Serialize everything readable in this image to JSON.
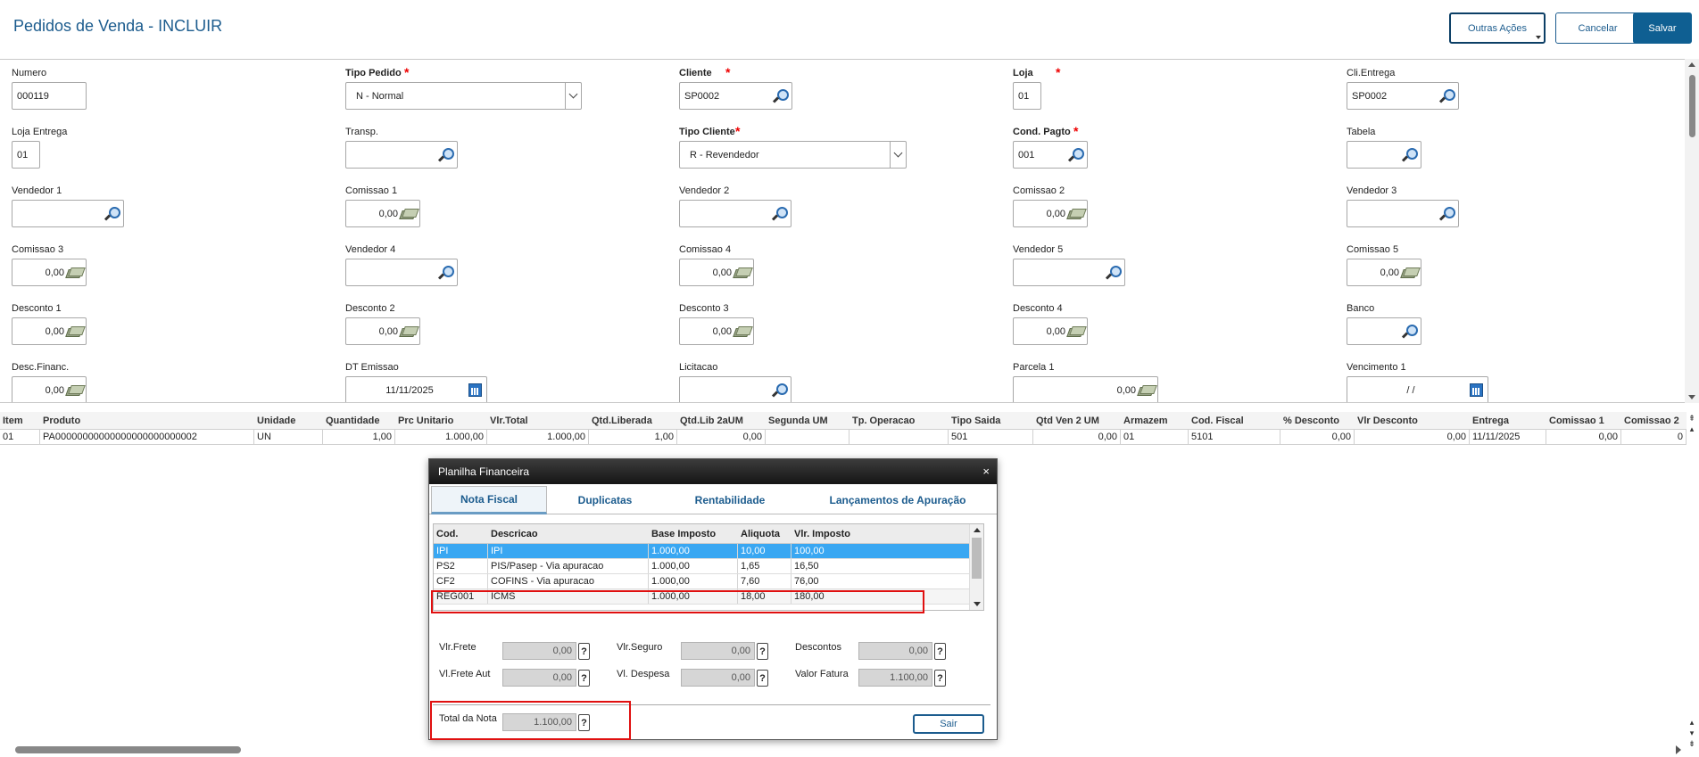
{
  "page": {
    "title": "Pedidos de Venda - INCLUIR"
  },
  "header": {
    "outras_label": "Outras Ações",
    "cancel_label": "Cancelar",
    "save_label": "Salvar"
  },
  "form": {
    "numero": {
      "label": "Numero",
      "value": "000119"
    },
    "tipo_pedido": {
      "label": "Tipo Pedido",
      "value": "N - Normal"
    },
    "cliente": {
      "label": "Cliente",
      "value": "SP0002"
    },
    "loja": {
      "label": "Loja",
      "value": "01"
    },
    "cli_entrega": {
      "label": "Cli.Entrega",
      "value": "SP0002"
    },
    "loja_entrega": {
      "label": "Loja Entrega",
      "value": "01"
    },
    "transp": {
      "label": "Transp.",
      "value": ""
    },
    "tipo_cliente": {
      "label": "Tipo Cliente",
      "value": "R - Revendedor"
    },
    "cond_pagto": {
      "label": "Cond. Pagto",
      "value": "001"
    },
    "tabela": {
      "label": "Tabela",
      "value": ""
    },
    "vendedor1": {
      "label": "Vendedor 1",
      "value": ""
    },
    "comissao1": {
      "label": "Comissao 1",
      "value": "0,00"
    },
    "vendedor2": {
      "label": "Vendedor 2",
      "value": ""
    },
    "comissao2": {
      "label": "Comissao 2",
      "value": "0,00"
    },
    "vendedor3": {
      "label": "Vendedor 3",
      "value": ""
    },
    "comissao3": {
      "label": "Comissao 3",
      "value": "0,00"
    },
    "vendedor4": {
      "label": "Vendedor 4",
      "value": ""
    },
    "comissao4": {
      "label": "Comissao 4",
      "value": "0,00"
    },
    "vendedor5": {
      "label": "Vendedor 5",
      "value": ""
    },
    "comissao5": {
      "label": "Comissao 5",
      "value": "0,00"
    },
    "desconto1": {
      "label": "Desconto 1",
      "value": "0,00"
    },
    "desconto2": {
      "label": "Desconto 2",
      "value": "0,00"
    },
    "desconto3": {
      "label": "Desconto 3",
      "value": "0,00"
    },
    "desconto4": {
      "label": "Desconto 4",
      "value": "0,00"
    },
    "banco": {
      "label": "Banco",
      "value": ""
    },
    "desc_financ": {
      "label": "Desc.Financ.",
      "value": "0,00"
    },
    "dt_emissao": {
      "label": "DT Emissao",
      "value": "11/11/2025"
    },
    "licitacao": {
      "label": "Licitacao",
      "value": ""
    },
    "parcela1": {
      "label": "Parcela 1",
      "value": "0,00"
    },
    "vencimento1": {
      "label": "Vencimento 1",
      "value": " / /"
    }
  },
  "grid": {
    "columns": [
      "Item",
      "Produto",
      "Unidade",
      "Quantidade",
      "Prc Unitario",
      "Vlr.Total",
      "Qtd.Liberada",
      "Qtd.Lib 2aUM",
      "Segunda UM",
      "Tp. Operacao",
      "Tipo Saida",
      "Qtd Ven 2 UM",
      "Armazem",
      "Cod. Fiscal",
      "% Desconto",
      "Vlr Desconto",
      "Entrega",
      "Comissao 1",
      "Comissao 2"
    ],
    "rows": [
      [
        "01",
        "PA00000000000000000000000002",
        "UN",
        "1,00",
        "1.000,00",
        "1.000,00",
        "1,00",
        "0,00",
        "",
        "",
        "501",
        "0,00",
        "01",
        "5101",
        "0,00",
        "0,00",
        "11/11/2025",
        "0,00",
        "0"
      ]
    ]
  },
  "modal": {
    "title": "Planilha Financeira",
    "close": "×",
    "tabs": [
      "Nota Fiscal",
      "Duplicatas",
      "Rentabilidade",
      "Lançamentos de Apuração"
    ],
    "table": {
      "columns": [
        "Cod.",
        "Descricao",
        "Base Imposto",
        "Aliquota",
        "Vlr. Imposto"
      ],
      "rows": [
        [
          "IPI",
          "IPI",
          "1.000,00",
          "10,00",
          "100,00"
        ],
        [
          "PS2",
          "PIS/Pasep - Via apuracao",
          "1.000,00",
          "1,65",
          "16,50"
        ],
        [
          "CF2",
          "COFINS - Via apuracao",
          "1.000,00",
          "7,60",
          "76,00"
        ],
        [
          "REG001",
          "ICMS",
          "1.000,00",
          "18,00",
          "180,00"
        ]
      ]
    },
    "fields": {
      "vlr_frete": {
        "label": "Vlr.Frete",
        "value": "0,00"
      },
      "vlr_seguro": {
        "label": "Vlr.Seguro",
        "value": "0,00"
      },
      "descontos": {
        "label": "Descontos",
        "value": "0,00"
      },
      "vl_frete_aut": {
        "label": "Vl.Frete Aut",
        "value": "0,00"
      },
      "vl_despesa": {
        "label": "Vl. Despesa",
        "value": "0,00"
      },
      "valor_fatura": {
        "label": "Valor Fatura",
        "value": "1.100,00"
      },
      "total_nota": {
        "label": "Total da Nota",
        "value": "1.100,00"
      }
    },
    "help": "?",
    "sair_label": "Sair"
  },
  "colors": {
    "brand": "#1c5c8e",
    "selected_row": "#39a7f2",
    "highlight": "#e01010"
  }
}
